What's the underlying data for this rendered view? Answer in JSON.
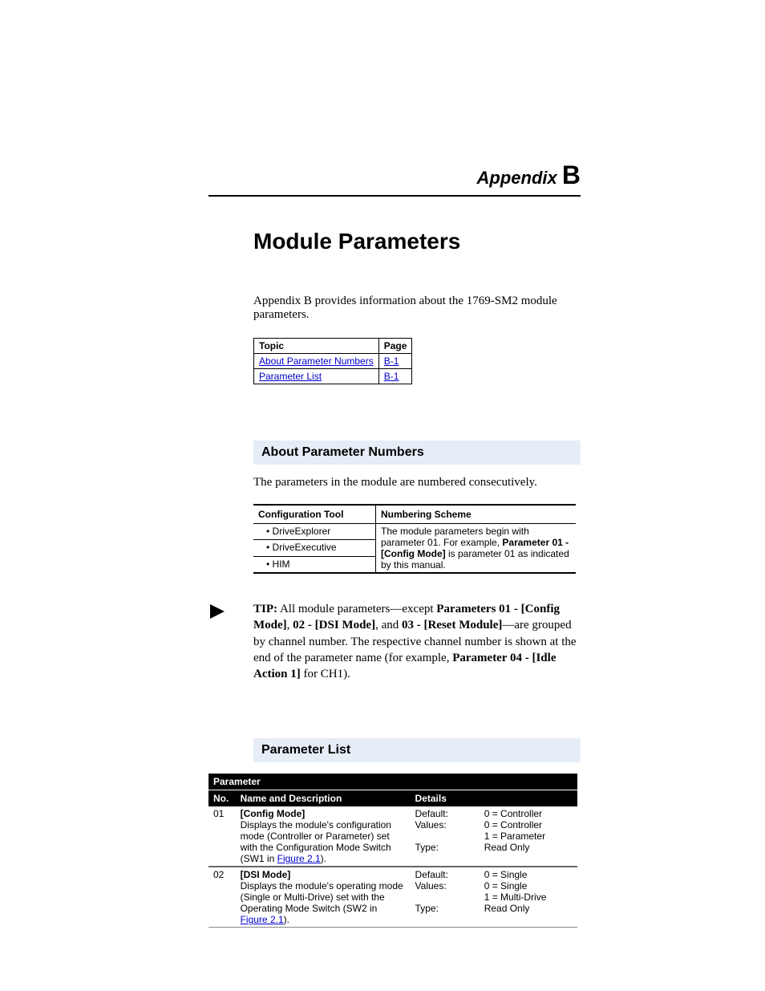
{
  "header": {
    "appendix_label": "Appendix",
    "appendix_letter": "B"
  },
  "title": "Module Parameters",
  "intro": "Appendix B provides information about the 1769-SM2 module parameters.",
  "topic_table": {
    "headers": {
      "topic": "Topic",
      "page": "Page"
    },
    "rows": [
      {
        "topic": "About Parameter Numbers",
        "page": "B-1"
      },
      {
        "topic": "Parameter List",
        "page": "B-1"
      }
    ]
  },
  "section1": {
    "heading": "About Parameter Numbers",
    "text": "The parameters in the module are numbered consecutively.",
    "table": {
      "headers": {
        "tool": "Configuration Tool",
        "scheme": "Numbering Scheme"
      },
      "tools": [
        "DriveExplorer",
        "DriveExecutive",
        "HIM"
      ],
      "scheme_pre": "The module parameters begin with parameter 01. For example, ",
      "scheme_bold": "Parameter 01 - [Config Mode]",
      "scheme_post": " is parameter 01 as indicated by this manual."
    }
  },
  "tip": {
    "label": "TIP:",
    "t1": "All module parameters—except ",
    "b1": "Parameters 01 - [Config Mode]",
    "t2": ", ",
    "b2": "02 - [DSI Mode]",
    "t3": ", and ",
    "b3": "03 - [Reset Module]",
    "t4": "—are grouped by channel number. The respective channel number is shown at the end of the parameter name (for example, ",
    "b4": "Parameter 04 - [Idle Action 1]",
    "t5": " for CH1)."
  },
  "section2": {
    "heading": "Parameter List",
    "table": {
      "super": "Parameter",
      "headers": {
        "no": "No.",
        "name": "Name and Description",
        "details": "Details"
      },
      "labels": {
        "default": "Default:",
        "values": "Values:",
        "type": "Type:"
      },
      "rows": [
        {
          "no": "01",
          "name": "[Config Mode]",
          "desc_pre": "Displays the module's configuration mode (Controller or Parameter) set with the Configuration Mode Switch (SW1 in ",
          "desc_link": "Figure 2.1",
          "desc_post": ").",
          "default": "0 = Controller",
          "values": "0 = Controller\n1 = Parameter",
          "type": "Read Only"
        },
        {
          "no": "02",
          "name": "[DSI Mode]",
          "desc_pre": "Displays the module's operating mode (Single or Multi-Drive) set with the Operating Mode Switch (SW2 in ",
          "desc_link": "Figure 2.1",
          "desc_post": ").",
          "default": "0 = Single",
          "values": "0 = Single\n1 = Multi-Drive",
          "type": "Read Only"
        }
      ]
    }
  }
}
